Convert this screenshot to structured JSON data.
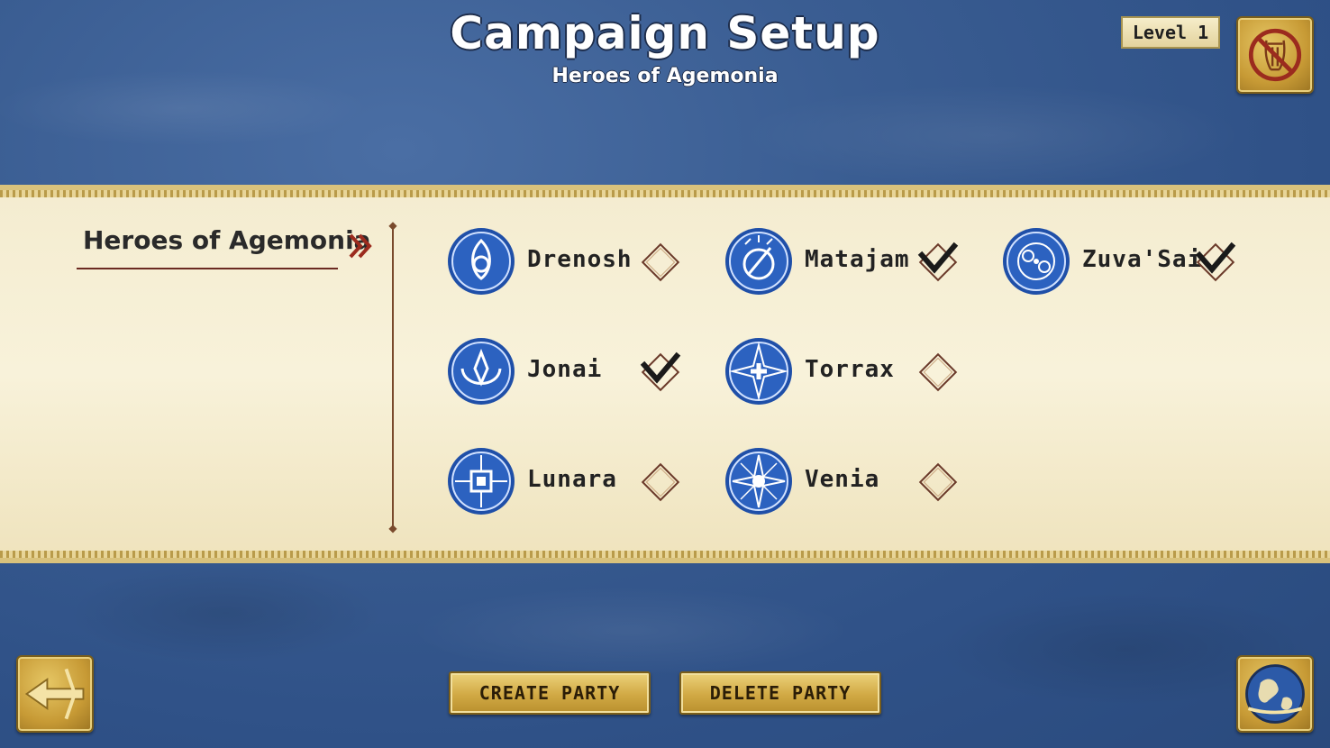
{
  "header": {
    "title": "Campaign Setup",
    "subtitle": "Heroes of Agemonia",
    "level_label": "Level 1"
  },
  "campaign": {
    "name": "Heroes of Agemonia"
  },
  "heroes": [
    {
      "name": "Drenosh",
      "selected": false
    },
    {
      "name": "Matajam",
      "selected": true
    },
    {
      "name": "Zuva'Sai",
      "selected": true
    },
    {
      "name": "Jonai",
      "selected": true
    },
    {
      "name": "Torrax",
      "selected": false
    },
    {
      "name": "Lunara",
      "selected": false
    },
    {
      "name": "Venia",
      "selected": false
    }
  ],
  "buttons": {
    "create_party": "CREATE PARTY",
    "delete_party": "DELETE PARTY"
  },
  "icons": {
    "music": "music-muted-icon",
    "back": "back-arrow-icon",
    "map": "world-map-icon"
  },
  "colors": {
    "background": "#3a5d92",
    "scroll": "#f6efd3",
    "gold": "#d1a944",
    "emblem": "#1f4fa8",
    "accent_red": "#9b2b1e"
  }
}
